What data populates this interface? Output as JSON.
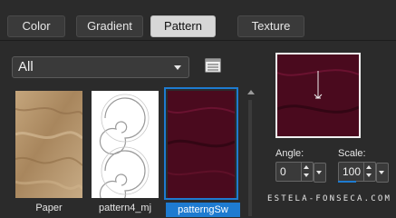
{
  "tabs": [
    {
      "label": "Color"
    },
    {
      "label": "Gradient"
    },
    {
      "label": "Pattern",
      "active": true
    },
    {
      "label": "Texture"
    }
  ],
  "library": {
    "dropdown_value": "All",
    "icon": "pattern-library-icon"
  },
  "patterns": [
    {
      "caption": "Paper",
      "icon": "paper-texture"
    },
    {
      "caption": "pattern4_mj",
      "icon": "spiral-pattern"
    },
    {
      "caption": "patterngSw",
      "icon": "burgundy-marble",
      "selected": true
    }
  ],
  "preview": {
    "icon": "pattern-preview"
  },
  "angle": {
    "label": "Angle:",
    "value": "0"
  },
  "scale": {
    "label": "Scale:",
    "value": "100"
  },
  "watermark": {
    "text": "ESTELA-FONSECA.COM"
  },
  "colors": {
    "selection": "#1e7bd0",
    "background": "#2b2b2b",
    "burgundy": "#4a0a1e"
  }
}
